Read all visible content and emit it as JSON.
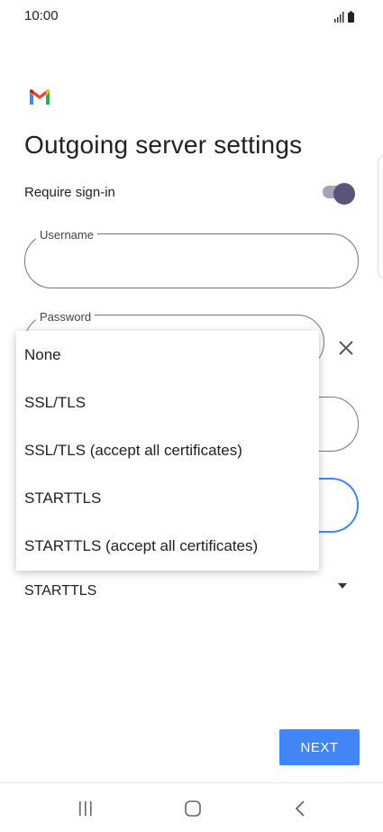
{
  "status_bar": {
    "time": "10:00"
  },
  "header": {
    "title": "Outgoing server settings"
  },
  "require_signin": {
    "label": "Require sign-in",
    "enabled": true
  },
  "fields": {
    "username": {
      "label": "Username",
      "value": ""
    },
    "password": {
      "label": "Password",
      "value": ""
    }
  },
  "security_menu": {
    "options": [
      "None",
      "SSL/TLS",
      "SSL/TLS (accept all certificates)",
      "STARTTLS",
      "STARTTLS (accept all certificates)"
    ]
  },
  "security_type": {
    "selected": "STARTTLS"
  },
  "footer": {
    "next_label": "NEXT"
  },
  "colors": {
    "accent": "#4285f4",
    "toggle_thumb": "#5a5478",
    "toggle_track": "#a7a3b7"
  },
  "icons": [
    "gmail-logo",
    "signal-icon",
    "battery-icon",
    "close-icon",
    "recents-icon",
    "home-icon",
    "back-icon"
  ]
}
